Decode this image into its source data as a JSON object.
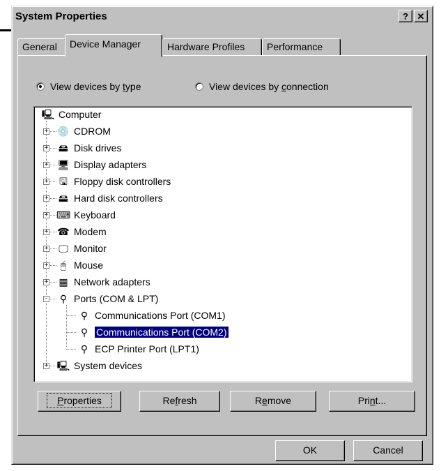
{
  "window": {
    "title": "System Properties",
    "help_label": "?",
    "close_label": "✕"
  },
  "tabs": [
    {
      "label": "General"
    },
    {
      "label": "Device Manager"
    },
    {
      "label": "Hardware Profiles"
    },
    {
      "label": "Performance"
    }
  ],
  "view_options": {
    "by_type": {
      "pre": "View devices by ",
      "key": "t",
      "post": "ype",
      "checked": true
    },
    "by_connection": {
      "pre": "View devices by ",
      "key": "c",
      "post": "onnection",
      "checked": false
    }
  },
  "tree": {
    "root": "Computer",
    "items": [
      {
        "label": "CDROM",
        "icon": "cdrom-icon",
        "expander": "+"
      },
      {
        "label": "Disk drives",
        "icon": "disk-drive-icon",
        "expander": "+"
      },
      {
        "label": "Display adapters",
        "icon": "display-adapter-icon",
        "expander": "+"
      },
      {
        "label": "Floppy disk controllers",
        "icon": "floppy-controller-icon",
        "expander": "+"
      },
      {
        "label": "Hard disk controllers",
        "icon": "hard-disk-controller-icon",
        "expander": "+"
      },
      {
        "label": "Keyboard",
        "icon": "keyboard-icon",
        "expander": "+"
      },
      {
        "label": "Modem",
        "icon": "modem-icon",
        "expander": "+"
      },
      {
        "label": "Monitor",
        "icon": "monitor-icon",
        "expander": "+"
      },
      {
        "label": "Mouse",
        "icon": "mouse-icon",
        "expander": "+"
      },
      {
        "label": "Network adapters",
        "icon": "network-adapter-icon",
        "expander": "+"
      },
      {
        "label": "Ports (COM & LPT)",
        "icon": "port-icon",
        "expander": "-"
      }
    ],
    "ports_children": [
      {
        "label": "Communications Port (COM1)",
        "selected": false
      },
      {
        "label": "Communications Port (COM2)",
        "selected": true
      },
      {
        "label": "ECP Printer Port (LPT1)",
        "selected": false
      }
    ],
    "last_item": {
      "label": "System devices",
      "icon": "system-devices-icon",
      "expander": "+"
    }
  },
  "buttons": {
    "properties": {
      "pre": "",
      "key": "P",
      "post": "roperties"
    },
    "refresh": {
      "pre": "Re",
      "key": "f",
      "post": "resh"
    },
    "remove": {
      "pre": "R",
      "key": "e",
      "post": "move"
    },
    "print": {
      "pre": "Pri",
      "key": "n",
      "post": "t..."
    },
    "ok": "OK",
    "cancel": "Cancel"
  },
  "colors": {
    "face": "#c0c0c0",
    "selection": "#000080"
  }
}
